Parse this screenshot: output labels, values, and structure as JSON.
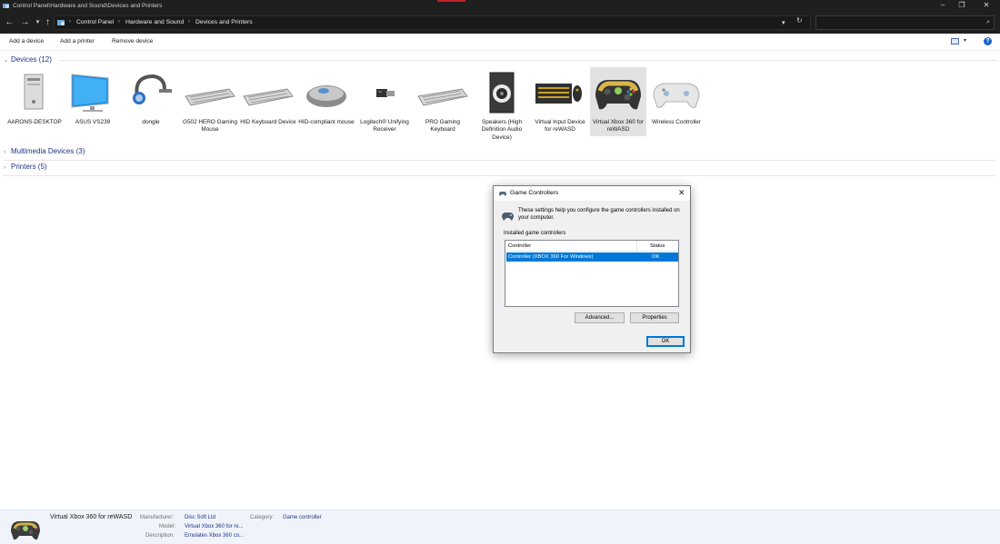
{
  "window": {
    "title": "Control Panel\\Hardware and Sound\\Devices and Printers",
    "minimize": "–",
    "restore": "❐",
    "close": "✕"
  },
  "address": {
    "back": "←",
    "forward": "→",
    "recent": "▾",
    "up": "↑",
    "crumbs": [
      "Control Panel",
      "Hardware and Sound",
      "Devices and Printers"
    ],
    "separator": "›",
    "dropdown": "▾",
    "refresh": "↻",
    "search_placeholder": "",
    "search_icon": "⌕"
  },
  "commands": {
    "add_device": "Add a device",
    "add_printer": "Add a printer",
    "remove_device": "Remove device",
    "view_dropdown": "▾",
    "help": "?"
  },
  "groups": {
    "devices": "Devices (12)",
    "multimedia": "Multimedia Devices (3)",
    "printers": "Printers (5)",
    "expanded_chevron": "⌄",
    "collapsed_chevron": "›"
  },
  "devices": [
    {
      "label": "AARONS-DESKTOP",
      "icon": "computer-tower-icon"
    },
    {
      "label": "ASUS VS239",
      "icon": "monitor-icon"
    },
    {
      "label": "dongle",
      "icon": "bluetooth-headset-icon"
    },
    {
      "label": "G502 HERO Gaming Mouse",
      "icon": "keyboard-icon"
    },
    {
      "label": "HID Keyboard Device",
      "icon": "keyboard-icon"
    },
    {
      "label": "HID-compliant mouse",
      "icon": "mouse-icon"
    },
    {
      "label": "Logitech® Unifying Receiver",
      "icon": "usb-receiver-icon"
    },
    {
      "label": "PRO Gaming Keyboard",
      "icon": "keyboard-icon"
    },
    {
      "label": "Speakers (High Definition Audio Device)",
      "icon": "speaker-icon"
    },
    {
      "label": "Virtual Input Device for reWASD",
      "icon": "keyboard-mouse-icon"
    },
    {
      "label": "Virtual Xbox 360 for reWASD",
      "icon": "xbox-controller-icon",
      "selected": true
    },
    {
      "label": "Wireless Controller",
      "icon": "gamepad-icon"
    }
  ],
  "dialog": {
    "title": "Game Controllers",
    "close": "✕",
    "info": "These settings help you configure the game controllers installed on your computer.",
    "installed_label": "Installed game controllers",
    "columns": {
      "controller": "Controller",
      "status": "Status"
    },
    "rows": [
      {
        "controller": "Controller (XBOX 360 For Windows)",
        "status": "OK"
      }
    ],
    "advanced": "Advanced...",
    "properties": "Properties",
    "ok": "OK"
  },
  "details": {
    "name": "Virtual Xbox 360 for reWASD",
    "manufacturer_label": "Manufacturer:",
    "manufacturer": "Disc Soft Ltd",
    "model_label": "Model:",
    "model": "Virtual Xbox 360 for re...",
    "description_label": "Description:",
    "description": "Emulates Xbox 360 co...",
    "category_label": "Category:",
    "category": "Game controller"
  }
}
